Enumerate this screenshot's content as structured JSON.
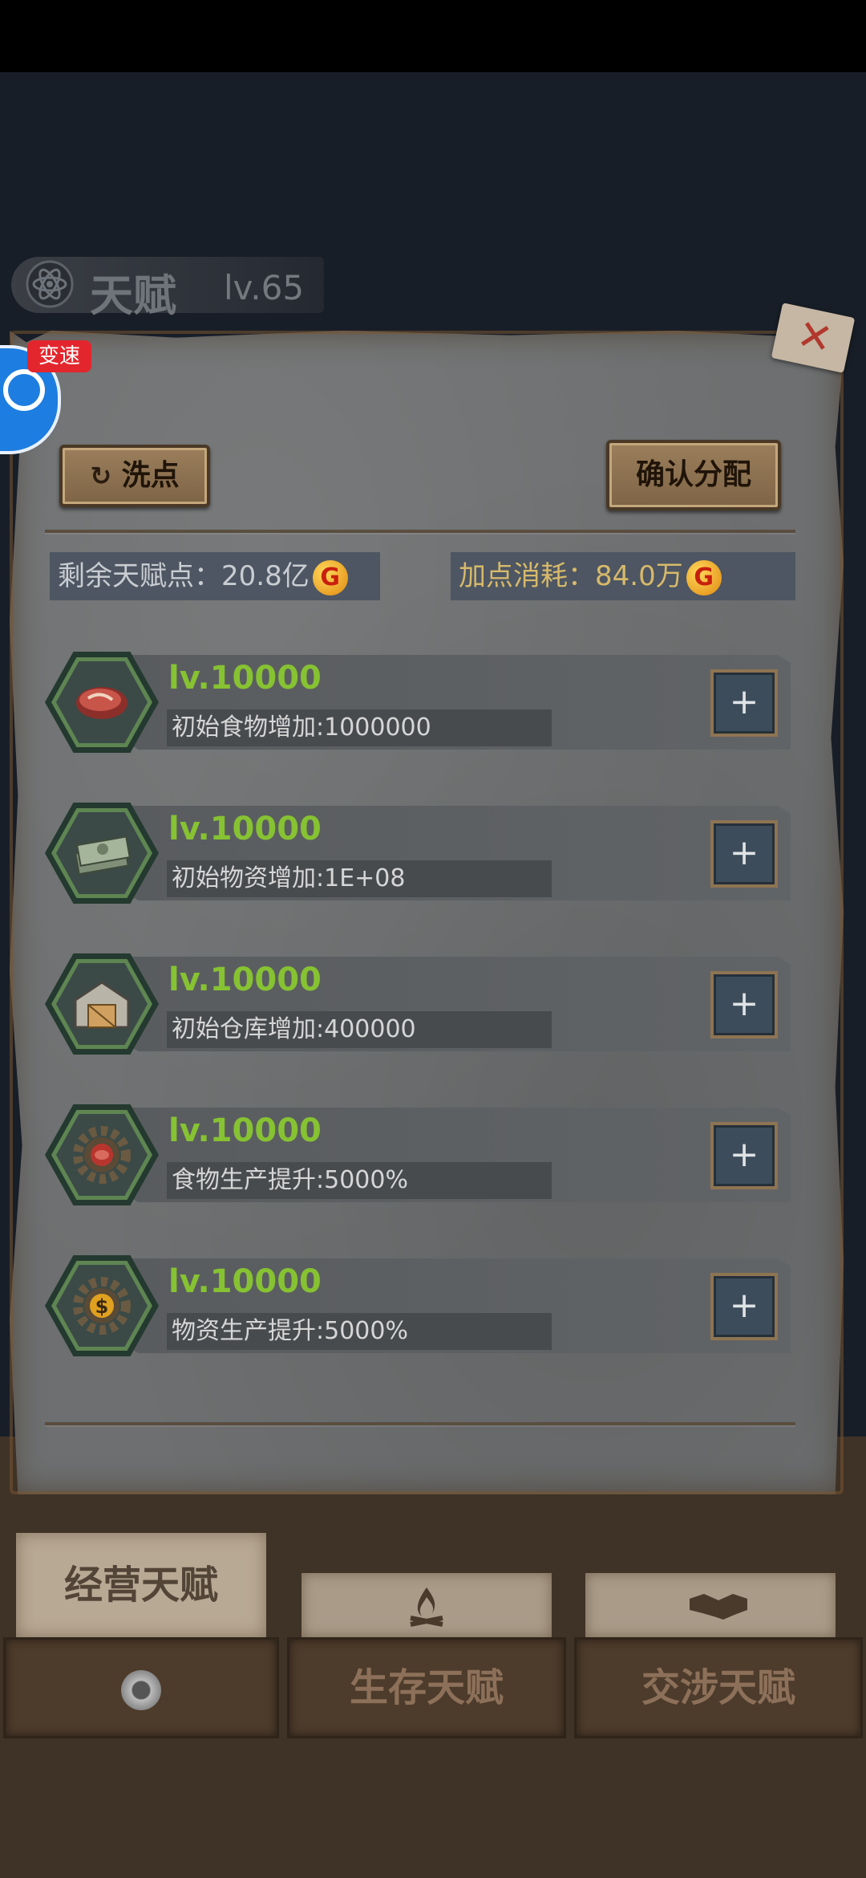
{
  "header": {
    "title": "天赋",
    "level": "lv.65"
  },
  "float_widget": {
    "badge": "变速"
  },
  "buttons": {
    "reset": "洗点",
    "confirm": "确认分配"
  },
  "stats": {
    "remaining_label": "剩余天赋点：20.8亿",
    "cost_label": "加点消耗：",
    "cost_value": "84.0万",
    "coin_symbol": "G"
  },
  "talents": [
    {
      "icon": "steak-icon",
      "level": "lv.10000",
      "desc": "初始食物增加:1000000"
    },
    {
      "icon": "money-stack-icon",
      "level": "lv.10000",
      "desc": "初始物资增加:1E+08"
    },
    {
      "icon": "warehouse-icon",
      "level": "lv.10000",
      "desc": "初始仓库增加:400000"
    },
    {
      "icon": "gear-food-icon",
      "level": "lv.10000",
      "desc": "食物生产提升:5000%"
    },
    {
      "icon": "gear-dollar-icon",
      "level": "lv.10000",
      "desc": "物资生产提升:5000%"
    }
  ],
  "plus_label": "+",
  "close_mark": "✕",
  "tabs": {
    "active": "经营天赋",
    "survival": "生存天赋",
    "negotiation": "交涉天赋"
  },
  "colors": {
    "level_green": "#86c232",
    "gold_text": "#d7b96a",
    "panel_gray": "#6d6f70"
  }
}
